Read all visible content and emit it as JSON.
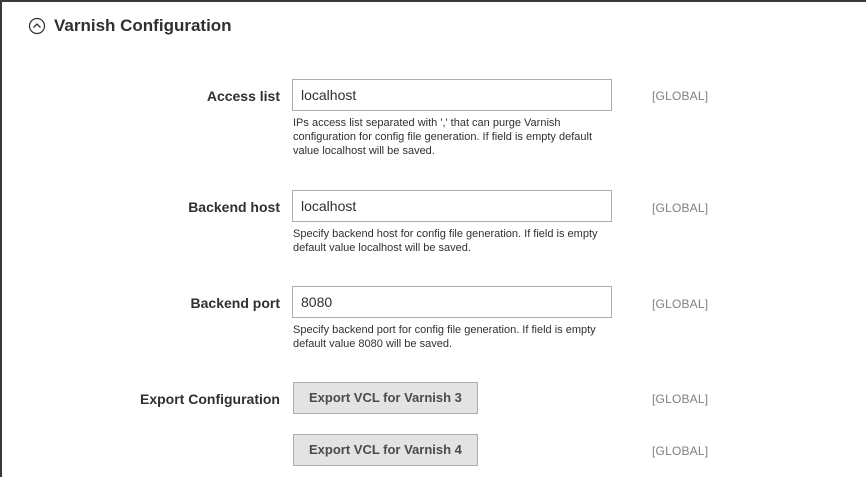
{
  "section": {
    "title": "Varnish Configuration"
  },
  "fields": {
    "access_list": {
      "label": "Access list",
      "value": "localhost",
      "note": "IPs access list separated with ',' that can purge Varnish configuration for config file generation. If field is empty default value localhost will be saved.",
      "scope": "[GLOBAL]"
    },
    "backend_host": {
      "label": "Backend host",
      "value": "localhost",
      "note": "Specify backend host for config file generation. If field is empty default value localhost will be saved.",
      "scope": "[GLOBAL]"
    },
    "backend_port": {
      "label": "Backend port",
      "value": "8080",
      "note": "Specify backend port for config file generation. If field is empty default value 8080 will be saved.",
      "scope": "[GLOBAL]"
    },
    "export": {
      "label": "Export Configuration",
      "button_v3": "Export VCL for Varnish 3",
      "scope_v3": "[GLOBAL]",
      "button_v4": "Export VCL for Varnish 4",
      "scope_v4": "[GLOBAL]"
    }
  },
  "icons": {
    "collapse": "chevron-up-circle-icon"
  }
}
